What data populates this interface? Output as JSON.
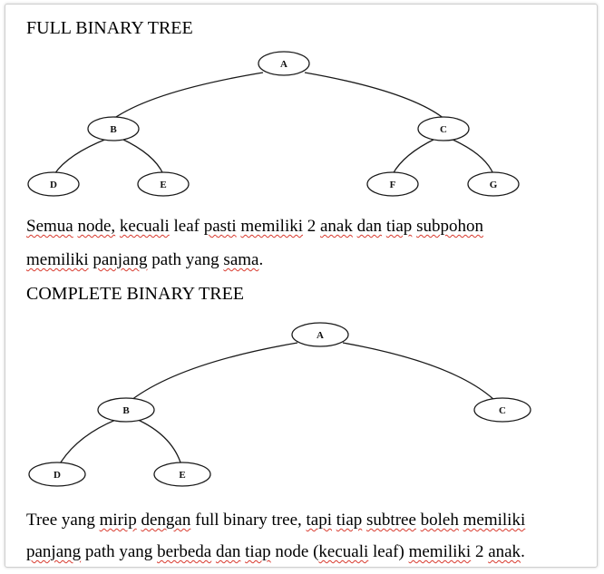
{
  "full_tree": {
    "title": "FULL BINARY TREE",
    "nodes": {
      "a": "A",
      "b": "B",
      "c": "C",
      "d": "D",
      "e": "E",
      "f": "F",
      "g": "G"
    },
    "description_line1": [
      "Semua",
      " ",
      "node,",
      " ",
      "kecuali",
      " leaf ",
      "pasti",
      " ",
      "memiliki",
      " 2 ",
      "anak",
      " ",
      "dan",
      " ",
      "tiap",
      " ",
      "subpohon"
    ],
    "description_line2": [
      "memiliki",
      " ",
      "panjang",
      " path yang ",
      "sama",
      "."
    ]
  },
  "complete_tree": {
    "title": "COMPLETE BINARY TREE",
    "nodes": {
      "a": "A",
      "b": "B",
      "c": "C",
      "d": "D",
      "e": "E"
    },
    "description_line1": [
      "Tree yang ",
      "mirip",
      " ",
      "dengan",
      " full binary tree, ",
      "tapi",
      " ",
      "tiap",
      " ",
      "subtree",
      " ",
      "boleh",
      " ",
      "memiliki"
    ],
    "description_line2": [
      "panjang",
      " path yang ",
      "berbeda",
      " ",
      "dan",
      " ",
      "tiap",
      " node (",
      "kecuali",
      " leaf) ",
      "memiliki",
      " 2 ",
      "anak",
      "."
    ]
  }
}
